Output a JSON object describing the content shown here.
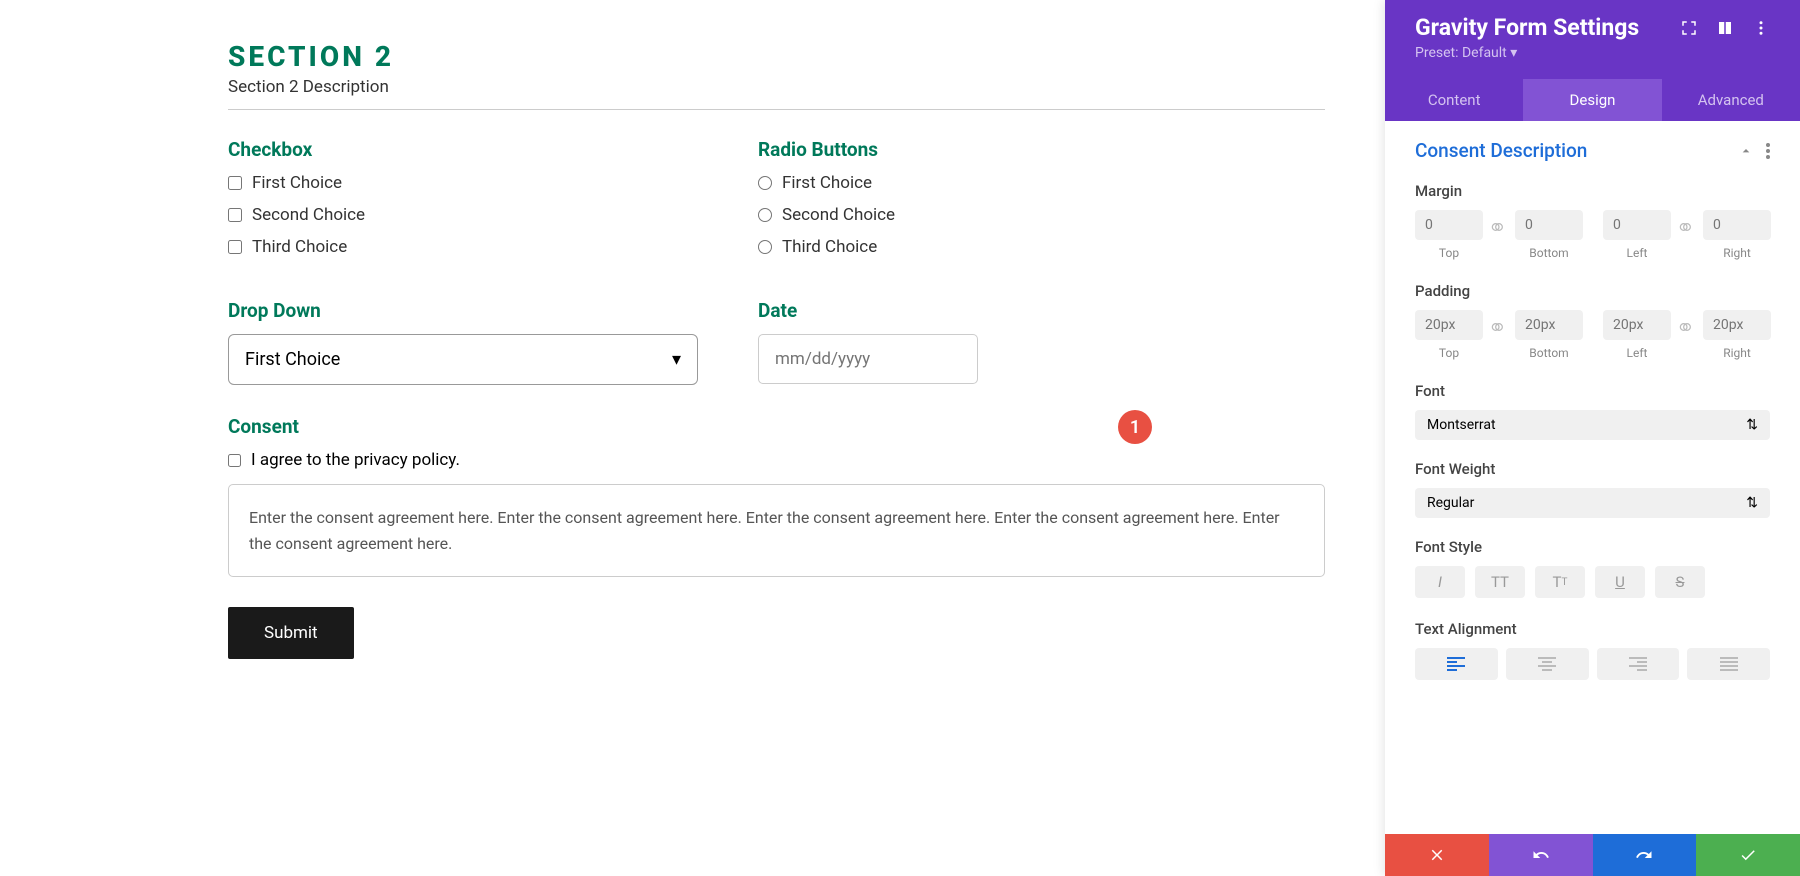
{
  "canvas": {
    "section_title": "SECTION 2",
    "section_desc": "Section 2 Description",
    "checkbox": {
      "label": "Checkbox",
      "choices": [
        "First Choice",
        "Second Choice",
        "Third Choice"
      ]
    },
    "radio": {
      "label": "Radio Buttons",
      "choices": [
        "First Choice",
        "Second Choice",
        "Third Choice"
      ]
    },
    "dropdown": {
      "label": "Drop Down",
      "value": "First Choice"
    },
    "date": {
      "label": "Date",
      "placeholder": "mm/dd/yyyy"
    },
    "consent": {
      "label": "Consent",
      "agree": "I agree to the privacy policy.",
      "text": "Enter the consent agreement here. Enter the consent agreement here. Enter the consent agreement here. Enter the consent agreement here. Enter the consent agreement here."
    },
    "submit_label": "Submit",
    "badge": "1"
  },
  "panel": {
    "title": "Gravity Form Settings",
    "preset": "Preset: Default ▾",
    "tabs": {
      "content": "Content",
      "design": "Design",
      "advanced": "Advanced"
    },
    "section": {
      "title": "Consent Description"
    },
    "margin": {
      "label": "Margin",
      "top_ph": "0",
      "bottom_ph": "0",
      "left_ph": "0",
      "right_ph": "0",
      "top_lbl": "Top",
      "bottom_lbl": "Bottom",
      "left_lbl": "Left",
      "right_lbl": "Right"
    },
    "padding": {
      "label": "Padding",
      "top_ph": "20px",
      "bottom_ph": "20px",
      "left_ph": "20px",
      "right_ph": "20px",
      "top_lbl": "Top",
      "bottom_lbl": "Bottom",
      "left_lbl": "Left",
      "right_lbl": "Right"
    },
    "font": {
      "label": "Font",
      "value": "Montserrat"
    },
    "font_weight": {
      "label": "Font Weight",
      "value": "Regular"
    },
    "font_style": {
      "label": "Font Style"
    },
    "text_alignment": {
      "label": "Text Alignment"
    }
  }
}
